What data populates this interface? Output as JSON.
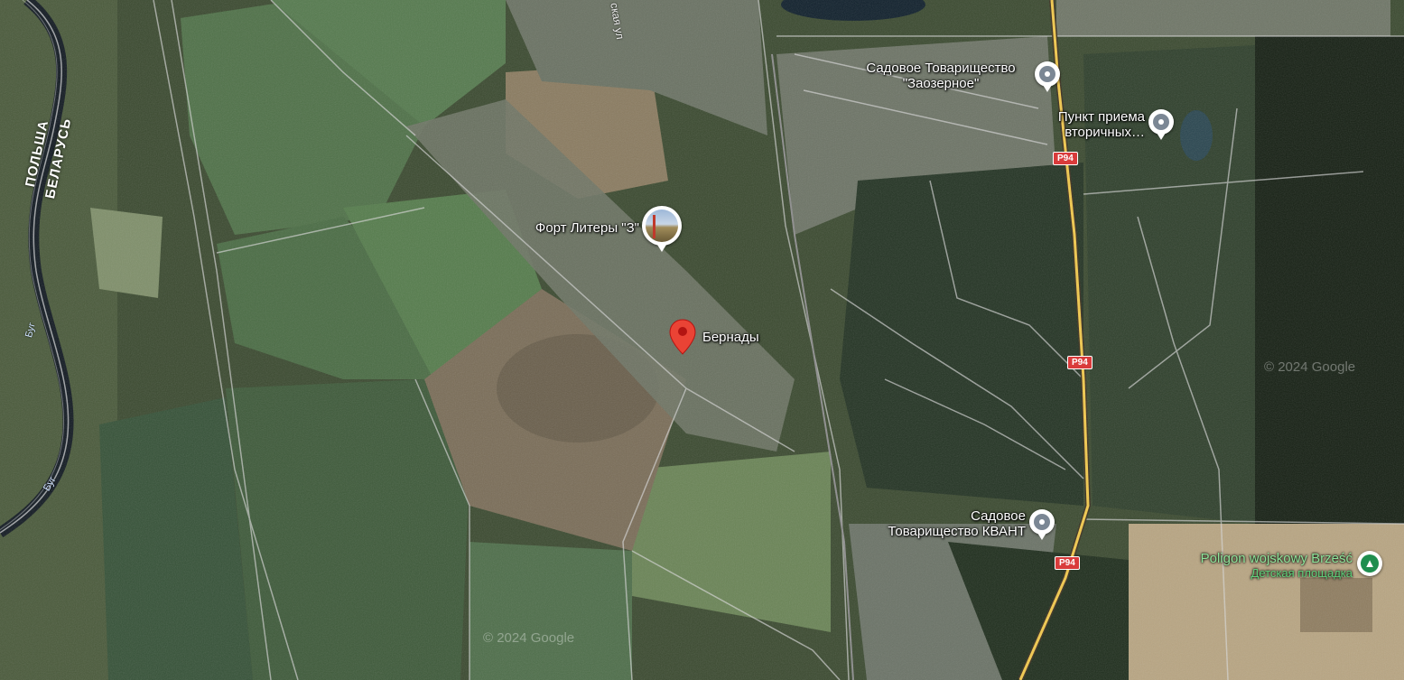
{
  "map": {
    "type": "satellite",
    "watermark": "© 2024 Google",
    "colors": {
      "field_green": "#4c6e45",
      "forest": "#1f2c1c",
      "bare_field": "#8a7a62",
      "road_yellow": "#f2c94c",
      "label_white": "#ffffff",
      "park_green": "#8ee49a",
      "route_shield_red": "#d93b3b",
      "selected_pin_red": "#ea4335"
    }
  },
  "border": {
    "country_left": "ПОЛЬША",
    "country_right": "БЕЛАРУСЬ"
  },
  "river": {
    "name": "Буг"
  },
  "street_fragment": "ская ул",
  "places": {
    "selected": {
      "name": "Бернады",
      "icon": "red-pin-icon"
    },
    "fort": {
      "name": "Форт Литеры \"З\"",
      "icon": "photo-thumbnail-icon"
    },
    "zaozernoe": {
      "line1": "Садовое Товарищество",
      "line2": "\"Заозерное\"",
      "icon": "location-pin-icon"
    },
    "recycling": {
      "line1": "Пункт приема",
      "line2": "вторичных…",
      "icon": "location-pin-icon"
    },
    "kvant": {
      "line1": "Садовое",
      "line2": "Товарищество КВАНТ",
      "icon": "location-pin-icon"
    },
    "poligon": {
      "line1": "Poligon wojskowy Brześć",
      "line2": "Детская площадка",
      "icon": "tree-icon"
    }
  },
  "roads": {
    "route_label": "P94",
    "shields": [
      "P94",
      "P94",
      "P94"
    ]
  }
}
